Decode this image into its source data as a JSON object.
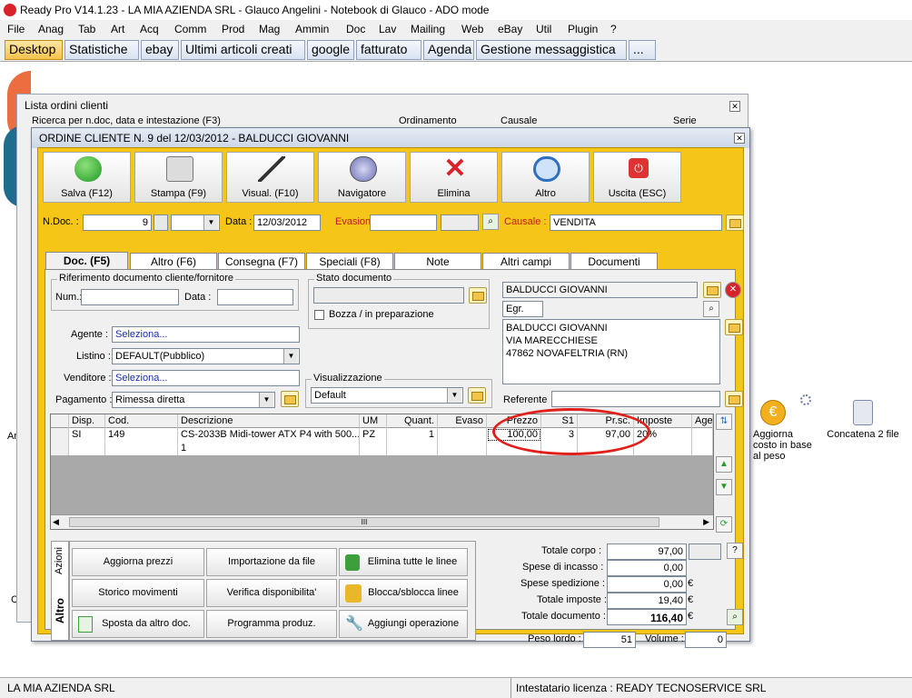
{
  "app": {
    "title": "Ready Pro V14.1.23 - LA MIA AZIENDA SRL - Glauco Angelini - Notebook di Glauco - ADO mode"
  },
  "menu": [
    "File",
    "Anag",
    "Tab",
    "Art",
    "Acq",
    "Comm",
    "Prod",
    "Mag",
    "Ammin",
    "Doc",
    "Lav",
    "Mailing",
    "Web",
    "eBay",
    "Util",
    "Plugin",
    "?"
  ],
  "tabs": [
    "Desktop",
    "Statistiche",
    "ebay",
    "Ultimi articoli creati",
    "google",
    "fatturato",
    "Agenda",
    "Gestione messaggistica",
    "..."
  ],
  "lista": {
    "title": "Lista ordini clienti",
    "ricerca": "Ricerca per n.doc, data e intestazione (F3)",
    "ordinamento": "Ordinamento",
    "causale": "Causale",
    "serie": "Serie"
  },
  "ordine": {
    "title": "ORDINE CLIENTE N. 9  del 12/03/2012 - BALDUCCI GIOVANNI",
    "toolbar": {
      "salva": "Salva (F12)",
      "stampa": "Stampa (F9)",
      "visual": "Visual. (F10)",
      "navigatore": "Navigatore",
      "elimina": "Elimina",
      "altro": "Altro",
      "uscita": "Uscita (ESC)"
    },
    "header": {
      "ndoc_label": "N.Doc. :",
      "ndoc": "9",
      "data_label": "Data :",
      "data": "12/03/2012",
      "evasione_label": "Evasione:",
      "causale_label": "Causale :",
      "causale": "VENDITA"
    },
    "formtabs": [
      "Doc. (F5)",
      "Altro (F6)",
      "Consegna (F7)",
      "Speciali (F8)",
      "Note",
      "Altri campi",
      "Documenti"
    ],
    "rif": {
      "caption": "Riferimento documento cliente/fornitore",
      "num_label": "Num.:",
      "data_label": "Data :"
    },
    "stato": {
      "caption": "Stato documento",
      "bozza": "Bozza / in preparazione"
    },
    "cliente": {
      "nome": "BALDUCCI GIOVANNI",
      "titolo": "Egr.",
      "indirizzo": [
        "BALDUCCI GIOVANNI",
        "VIA MARECCHIESE",
        "47862 NOVAFELTRIA (RN)"
      ],
      "referente_label": "Referente"
    },
    "agente": {
      "label": "Agente :",
      "value": "Seleziona..."
    },
    "listino": {
      "label": "Listino :",
      "value": "DEFAULT(Pubblico)"
    },
    "venditore": {
      "label": "Venditore :",
      "value": "Seleziona..."
    },
    "pagamento": {
      "label": "Pagamento :",
      "value": "Rimessa diretta"
    },
    "visualizzazione": {
      "caption": "Visualizzazione",
      "value": "Default"
    },
    "grid": {
      "headers": [
        "Disp.",
        "Cod.",
        "Descrizione",
        "UM",
        "Quant.",
        "Evaso",
        "Prezzo",
        "S1",
        "Pr.sc.",
        "Imposte",
        "Agen"
      ],
      "rows": [
        [
          "SI",
          "149",
          "CS-2033B Midi-tower ATX P4 with 500...",
          "PZ",
          "1",
          "",
          "100,00",
          "3",
          "97,00",
          "20%",
          ""
        ],
        [
          "",
          "",
          "1",
          "",
          "",
          "",
          "",
          "",
          "",
          "",
          ""
        ]
      ],
      "scroll_glyph": "III"
    },
    "azioni": {
      "tab_azioni": "Azioni",
      "tab_altro": "Altro",
      "buttons": [
        "Aggiorna prezzi",
        "Importazione da file",
        "Elimina tutte le linee",
        "Storico movimenti",
        "Verifica disponibilita'",
        "Blocca/sblocca linee",
        "Sposta da altro doc.",
        "Programma produz.",
        "Aggiungi operazione"
      ]
    },
    "totali": {
      "totale_corpo_label": "Totale corpo :",
      "totale_corpo": "97,00",
      "spese_incasso_label": "Spese di incasso :",
      "spese_incasso": "0,00",
      "spese_spedizione_label": "Spese spedizione :",
      "spese_spedizione": "0,00",
      "totale_imposte_label": "Totale imposte :",
      "totale_imposte": "19,40",
      "totale_documento_label": "Totale documento :",
      "totale_documento": "116,40",
      "euro": "€",
      "peso_label": "Peso lordo :",
      "peso": "51",
      "volume_label": "Volume :",
      "volume": "0",
      "help": "?"
    }
  },
  "desktop_icons": {
    "aggiorna_costo": "Aggiorna costo in base al peso",
    "concatena": "Concatena 2 file"
  },
  "status": {
    "left": "LA MIA AZIENDA SRL",
    "right": "Intestatario licenza : READY TECNOSERVICE SRL"
  },
  "colors": {
    "accent": "#f5c518",
    "highlight": "#e0201b",
    "active_tab": "#f6c24c"
  }
}
